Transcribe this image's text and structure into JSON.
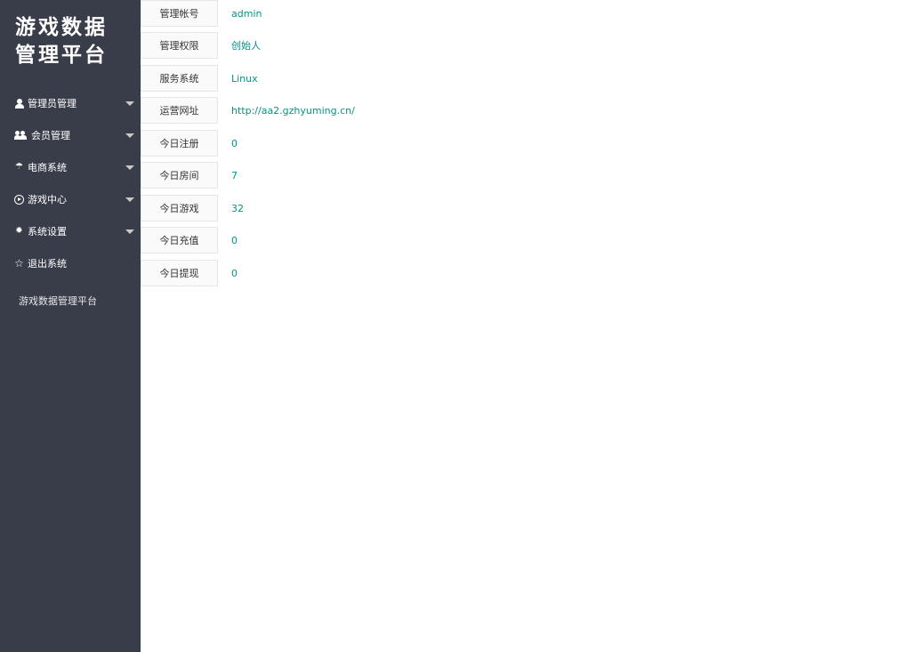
{
  "sidebar": {
    "brand_line1": "游戏数据",
    "brand_line2": "管理平台",
    "items": [
      {
        "label": "管理员管理",
        "icon": "user-icon",
        "has_submenu": true
      },
      {
        "label": "会员管理",
        "icon": "users-icon",
        "has_submenu": true
      },
      {
        "label": "电商系统",
        "icon": "umbrella-icon",
        "has_submenu": true
      },
      {
        "label": "游戏中心",
        "icon": "play-circle-icon",
        "has_submenu": true
      },
      {
        "label": "系统设置",
        "icon": "gear-icon",
        "has_submenu": true
      },
      {
        "label": "退出系统",
        "icon": "star-icon",
        "has_submenu": false
      }
    ],
    "footer": "游戏数据管理平台"
  },
  "info": [
    {
      "label": "管理帐号",
      "value": "admin"
    },
    {
      "label": "管理权限",
      "value": "创始人"
    },
    {
      "label": "服务系统",
      "value": "Linux"
    },
    {
      "label": "运营网址",
      "value": "http://aa2.gzhyuming.cn/"
    },
    {
      "label": "今日注册",
      "value": "0"
    },
    {
      "label": "今日房间",
      "value": "7"
    },
    {
      "label": "今日游戏",
      "value": "32"
    },
    {
      "label": "今日充值",
      "value": "0"
    },
    {
      "label": "今日提现",
      "value": "0"
    }
  ],
  "colors": {
    "sidebar_bg": "#393d49",
    "value_text": "#009688",
    "label_bg": "#fafafa",
    "border": "#e6e6e6"
  }
}
